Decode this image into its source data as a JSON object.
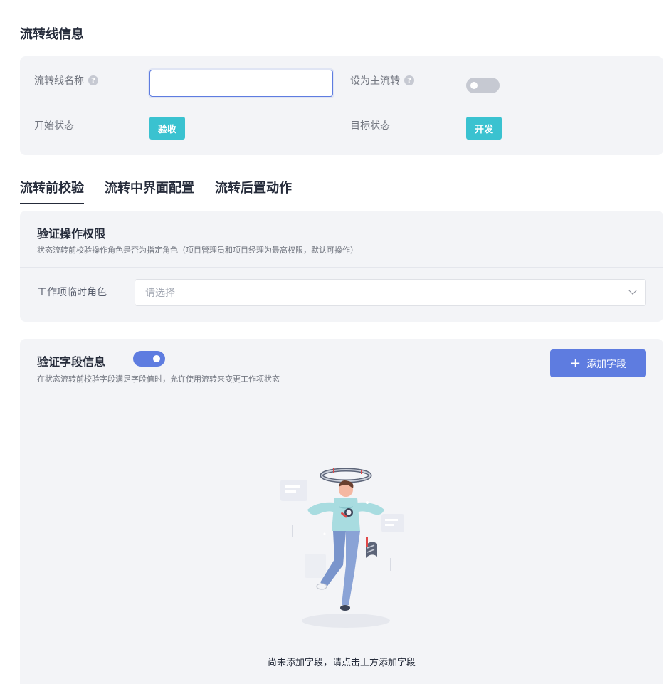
{
  "flow_info": {
    "section_title": "流转线信息",
    "name_label": "流转线名称",
    "name_value": "",
    "main_flow_label": "设为主流转",
    "main_flow_enabled": false,
    "start_state_label": "开始状态",
    "start_state_value": "验收",
    "target_state_label": "目标状态",
    "target_state_value": "开发",
    "tag_color": "#3ac2d0"
  },
  "tabs": [
    {
      "label": "流转前校验",
      "active": true
    },
    {
      "label": "流转中界面配置",
      "active": false
    },
    {
      "label": "流转后置动作",
      "active": false
    }
  ],
  "permission": {
    "title": "验证操作权限",
    "description": "状态流转前校验操作角色是否为指定角色（项目管理员和项目经理为最高权限，默认可操作）",
    "role_label": "工作项临时角色",
    "role_placeholder": "请选择"
  },
  "field_info": {
    "title": "验证字段信息",
    "enabled": true,
    "description": "在状态流转前校验字段满足字段值时，允许使用流转来变更工作项状态",
    "add_button_label": "添加字段",
    "empty_text": "尚未添加字段，请点击上方添加字段",
    "accent_color": "#5e7ce0"
  }
}
